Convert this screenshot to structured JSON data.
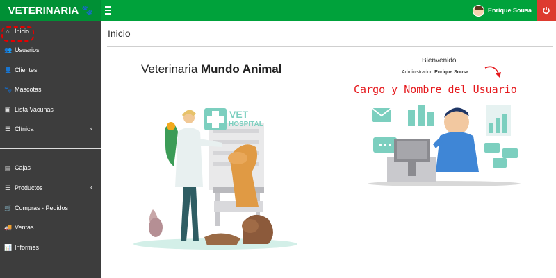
{
  "brand": {
    "title": "VETERINARIA",
    "icon": "paw-icon"
  },
  "topbar": {
    "user_name": "Enrique Sousa",
    "menu_icon": "hamburger-icon",
    "power_icon": "power-icon",
    "color": "#00a23b"
  },
  "sidebar": {
    "items": [
      {
        "label": "Inicio",
        "icon": "home-icon"
      },
      {
        "label": "Usuarios",
        "icon": "users-icon"
      },
      {
        "label": "Clientes",
        "icon": "user-group-icon"
      },
      {
        "label": "Mascotas",
        "icon": "paw-icon"
      },
      {
        "label": "Lista Vacunas",
        "icon": "syringe-icon"
      },
      {
        "label": "Clínica",
        "icon": "list-icon"
      },
      {
        "label": "Cajas",
        "icon": "cash-box-icon"
      },
      {
        "label": "Productos",
        "icon": "list-icon"
      },
      {
        "label": "Compras - Pedidos",
        "icon": "cart-icon"
      },
      {
        "label": "Ventas",
        "icon": "truck-icon"
      },
      {
        "label": "Informes",
        "icon": "chart-icon"
      }
    ]
  },
  "main": {
    "page_title": "Inicio",
    "clinic_prefix": "Veterinaria",
    "clinic_name": "Mundo Animal",
    "welcome": "Bienvenido",
    "admin_label": "Administrador:",
    "admin_name": "Enrique Sousa",
    "annotation": "Cargo y Nombre del Usuario",
    "hospital_sign_line1": "VET",
    "hospital_sign_line2": "HOSPITAL"
  }
}
